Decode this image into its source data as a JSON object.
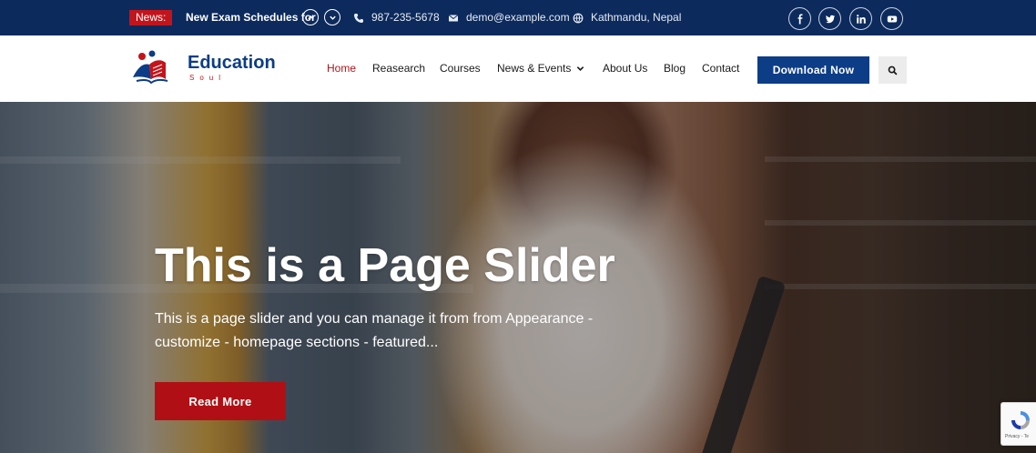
{
  "topbar": {
    "news_badge": "News:",
    "news_text": "New Exam Schedules for",
    "phone": "987-235-5678",
    "email": "demo@example.com",
    "location": "Kathmandu, Nepal",
    "social": [
      "facebook-icon",
      "twitter-icon",
      "linkedin-icon",
      "youtube-icon"
    ]
  },
  "logo": {
    "title": "Education",
    "subtitle": "Soul"
  },
  "nav": {
    "items": [
      {
        "label": "Home"
      },
      {
        "label": "Reasearch"
      },
      {
        "label": "Courses"
      },
      {
        "label": "News & Events"
      },
      {
        "label": "About Us"
      },
      {
        "label": "Blog"
      },
      {
        "label": "Contact"
      }
    ],
    "download_label": "Download Now"
  },
  "hero": {
    "title": "This is a Page Slider",
    "description": "This is a page slider and you can manage it from from Appearance - customize - homepage sections - featured...",
    "button_label": "Read More"
  },
  "recaptcha": {
    "text": "Privacy - Te"
  },
  "colors": {
    "topbar_bg": "#0c2a5c",
    "brand_blue": "#0c3d86",
    "brand_red": "#b01015"
  }
}
